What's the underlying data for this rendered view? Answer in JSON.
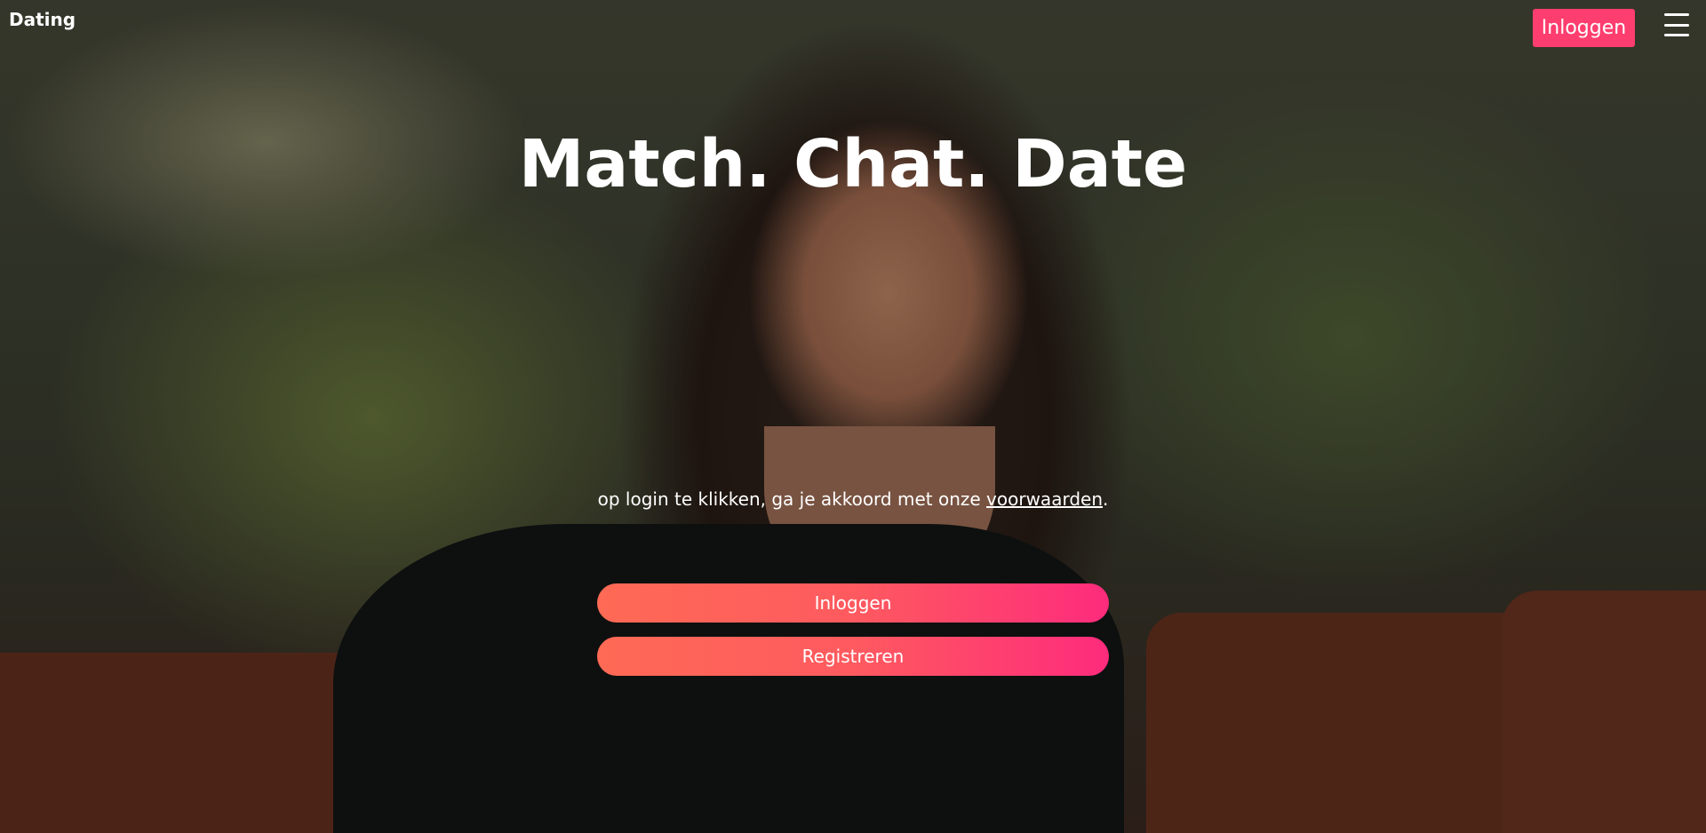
{
  "header": {
    "brand": "Dating",
    "login_label": "Inloggen",
    "menu_icon": "hamburger-menu-icon"
  },
  "hero": {
    "headline": "Match. Chat. Date",
    "terms_prefix": "op login te klikken, ga je akkoord met onze ",
    "terms_link": "voorwaarden",
    "terms_suffix": ".",
    "login_button": "Inloggen",
    "register_button": "Registreren"
  },
  "colors": {
    "accent": "#fe3e6e",
    "gradient_start": "#fe6a55",
    "gradient_end": "#fe2b7c"
  }
}
